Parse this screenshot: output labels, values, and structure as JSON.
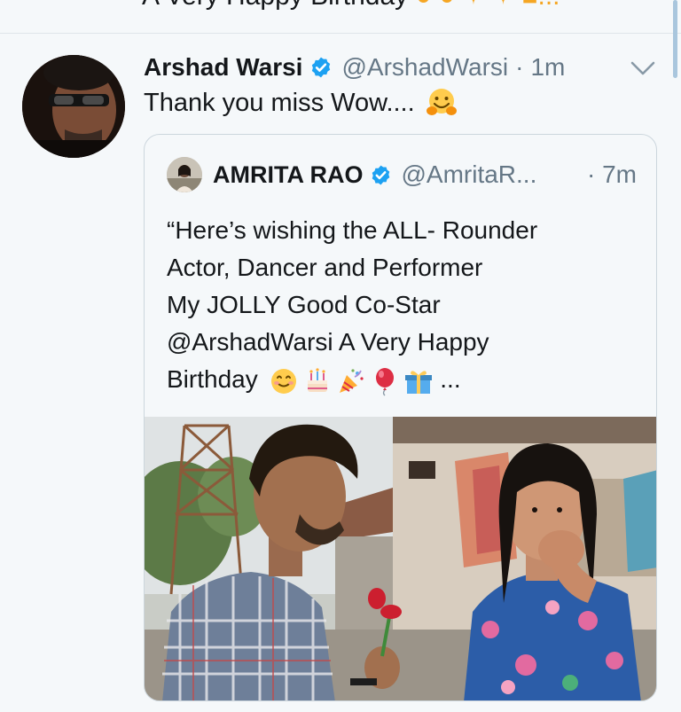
{
  "previous_tweet": {
    "text_fragment": "A Very Happy Birthday"
  },
  "tweet": {
    "display_name": "Arshad Warsi",
    "handle": "@ArshadWarsi",
    "separator": "·",
    "time": "1m",
    "text": "Thank you miss Wow....",
    "emoji": "hugging-face",
    "verified": true
  },
  "quoted_tweet": {
    "display_name": "AMRITA RAO",
    "handle": "@AmritaR...",
    "time": "· 7m",
    "verified": true,
    "lines": [
      "“Here’s wishing the ALL- Rounder",
      "Actor, Dancer and Performer",
      "My JOLLY Good Co-Star",
      "@ArshadWarsi A Very Happy",
      "Birthday"
    ],
    "trailing_text": "...",
    "emojis": [
      "smiling-face",
      "birthday-cake",
      "party-popper",
      "balloon",
      "wrapped-gift"
    ],
    "media": "photo"
  },
  "colors": {
    "background": "#f5f8fa",
    "text": "#14171a",
    "secondary": "#657786",
    "verified_blue": "#1da1f2",
    "border": "#ccd6dd"
  }
}
